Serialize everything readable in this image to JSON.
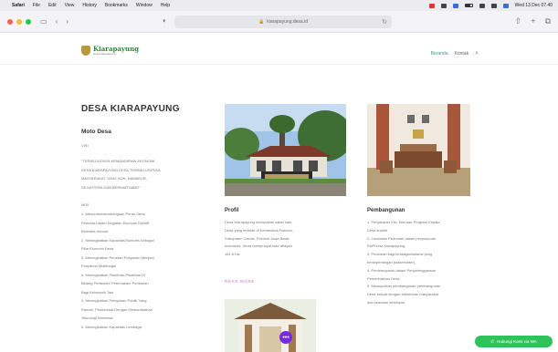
{
  "menubar": {
    "items": [
      "Safari",
      "File",
      "Edit",
      "View",
      "History",
      "Bookmarks",
      "Window",
      "Help"
    ],
    "clock": "Wed 13 Dec 07.40"
  },
  "browser": {
    "url": "kiarapayung.desa.id"
  },
  "site": {
    "logo_title": "Kiarapayung",
    "logo_sub": "Desa Kiarapayung",
    "nav": [
      "Beranda",
      "Kontak"
    ]
  },
  "left": {
    "title": "DESA KIARAPAYUNG",
    "moto_heading": "Moto Desa",
    "visi_label": "VISI",
    "visi_lines": [
      "\"TERWUJUDNYA KEMANDIRIAN EKONOMI",
      "DESA KIARAPAYUNG DESA TERINKLUSIFNYA",
      "MASYARAKAT YANG KOH, NAMAKUR,",
      "SEJAHTERA DAN BERMARTABAT\""
    ],
    "misi_label": "MISI",
    "misi_lines": [
      "1. Menumbuhkembangkan Peran Serta",
      "Pemuda Dalam Kegiatan Ekonomi Kreatif",
      "Berbasis Inovasi",
      "2. Meningkatkan Kapasitas Bumdes Sebagai",
      "Pilar Ekonomi Desa",
      "3. Meningkatkan Peranan Posyandu Menjadi",
      "Posyandu Multifungsi",
      "4. Meningkatkan Pelatihan-Pelatihan Di",
      "Bidang Pertanian/ Peternakan/ Perikanan",
      "Bagi Kelompok Tani",
      "5. Meningkatkan Pelayanan Publik Yang",
      "Ramah, Profesional Dengan Memanfaatkan",
      "Teknologi Informasi",
      "6. Meningkatkan Kapasitas Lembaga"
    ]
  },
  "profil": {
    "title": "Profil",
    "lines": [
      "Desa Kiarapayung merupakan salah satu",
      "Desa yang terletak di Kecamatan Rancah,",
      "Kabupaten Ciamis, Provinsi Jawa Barat,",
      "Indonesia. Serta mempunyai luas wilayah",
      "181,8 Ha."
    ],
    "read_more": "READ MORE"
  },
  "pembangunan": {
    "title": "Pembangunan",
    "lines": [
      "1. Penjabaran Visi, Misi dan Program Kepala",
      "Desa terpilih.",
      "2. Landasan Pedoman dalam penyusunan",
      "RAPDesa Kiarapayung.",
      "3. Pedoman bagi lembaga/instansi yang",
      "berkepentingan (stakeholder).",
      "4. Pembangunan dalam Penyelenggaraan",
      "Pemerintahan Desa.",
      "5. Mewujudkan pembangunan pembangunan",
      "Desa sesuai dengan kebutuhan masyarakat",
      "dan keadaan setempat."
    ]
  },
  "widgets": {
    "whatsapp_label": "Hubungi Kami via WA",
    "dots_label": "•••"
  },
  "colors": {
    "accent": "#2aa58a",
    "read_more": "#d9a0d6",
    "whatsapp": "#2fc25a",
    "fab": "#7a2be0"
  }
}
